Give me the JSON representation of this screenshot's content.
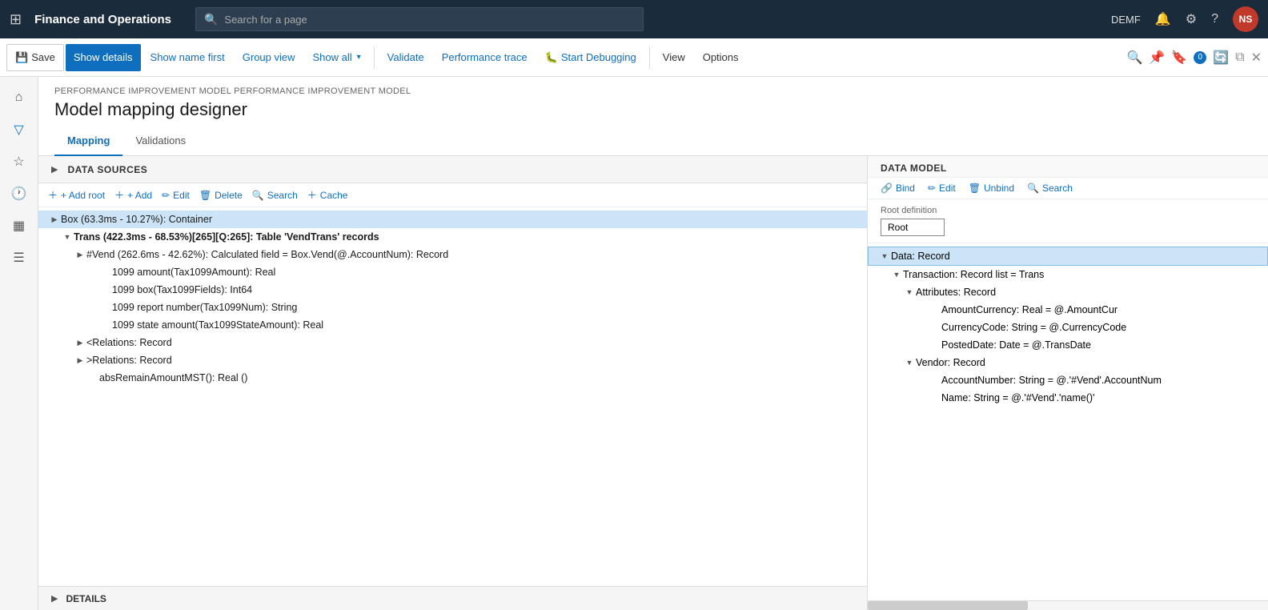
{
  "app": {
    "title": "Finance and Operations",
    "search_placeholder": "Search for a page",
    "env": "DEMF",
    "avatar": "NS"
  },
  "toolbar": {
    "save_label": "Save",
    "show_details_label": "Show details",
    "show_name_first_label": "Show name first",
    "group_view_label": "Group view",
    "show_all_label": "Show all",
    "validate_label": "Validate",
    "performance_trace_label": "Performance trace",
    "start_debugging_label": "Start Debugging",
    "view_label": "View",
    "options_label": "Options"
  },
  "breadcrumb": "PERFORMANCE IMPROVEMENT MODEL PERFORMANCE IMPROVEMENT MODEL",
  "page_title": "Model mapping designer",
  "tabs": [
    {
      "label": "Mapping",
      "active": true
    },
    {
      "label": "Validations",
      "active": false
    }
  ],
  "data_sources": {
    "header": "DATA SOURCES",
    "toolbar": {
      "add_root": "+ Add root",
      "add": "+ Add",
      "edit": "Edit",
      "delete": "Delete",
      "search": "Search",
      "cache": "Cache"
    },
    "tree": [
      {
        "level": 0,
        "expanded": true,
        "selected": true,
        "label": "Box (63.3ms - 10.27%): Container",
        "has_expand": true
      },
      {
        "level": 1,
        "expanded": true,
        "selected": false,
        "label": "Trans (422.3ms - 68.53%)[265][Q:265]: Table 'VendTrans' records",
        "has_expand": true
      },
      {
        "level": 2,
        "expanded": true,
        "selected": false,
        "label": "#Vend (262.6ms - 42.62%): Calculated field = Box.Vend(@.AccountNum): Record",
        "has_expand": true
      },
      {
        "level": 3,
        "expanded": false,
        "selected": false,
        "label": "1099 amount(Tax1099Amount): Real",
        "has_expand": false
      },
      {
        "level": 3,
        "expanded": false,
        "selected": false,
        "label": "1099 box(Tax1099Fields): Int64",
        "has_expand": false
      },
      {
        "level": 3,
        "expanded": false,
        "selected": false,
        "label": "1099 report number(Tax1099Num): String",
        "has_expand": false
      },
      {
        "level": 3,
        "expanded": false,
        "selected": false,
        "label": "1099 state amount(Tax1099StateAmount): Real",
        "has_expand": false
      },
      {
        "level": 2,
        "expanded": false,
        "selected": false,
        "label": "<Relations: Record",
        "has_expand": true
      },
      {
        "level": 2,
        "expanded": false,
        "selected": false,
        "label": ">Relations: Record",
        "has_expand": true
      },
      {
        "level": 2,
        "expanded": false,
        "selected": false,
        "label": "absRemainAmountMST(): Real ()",
        "has_expand": false
      }
    ]
  },
  "details": {
    "header": "DETAILS"
  },
  "data_model": {
    "header": "DATA MODEL",
    "toolbar": {
      "bind": "Bind",
      "edit": "Edit",
      "unbind": "Unbind",
      "search": "Search"
    },
    "root_definition_label": "Root definition",
    "root_value": "Root",
    "tree": [
      {
        "level": 0,
        "expanded": true,
        "selected": true,
        "label": "Data: Record",
        "has_expand": true
      },
      {
        "level": 1,
        "expanded": true,
        "selected": false,
        "label": "Transaction: Record list = Trans",
        "has_expand": true
      },
      {
        "level": 2,
        "expanded": true,
        "selected": false,
        "label": "Attributes: Record",
        "has_expand": true
      },
      {
        "level": 3,
        "expanded": false,
        "selected": false,
        "label": "AmountCurrency: Real = @.AmountCur",
        "has_expand": false
      },
      {
        "level": 3,
        "expanded": false,
        "selected": false,
        "label": "CurrencyCode: String = @.CurrencyCode",
        "has_expand": false
      },
      {
        "level": 3,
        "expanded": false,
        "selected": false,
        "label": "PostedDate: Date = @.TransDate",
        "has_expand": false
      },
      {
        "level": 2,
        "expanded": true,
        "selected": false,
        "label": "Vendor: Record",
        "has_expand": true
      },
      {
        "level": 3,
        "expanded": false,
        "selected": false,
        "label": "AccountNumber: String = @.'#Vend'.AccountNum",
        "has_expand": false
      },
      {
        "level": 3,
        "expanded": false,
        "selected": false,
        "label": "Name: String = @.'#Vend'.'name()'",
        "has_expand": false
      }
    ]
  }
}
